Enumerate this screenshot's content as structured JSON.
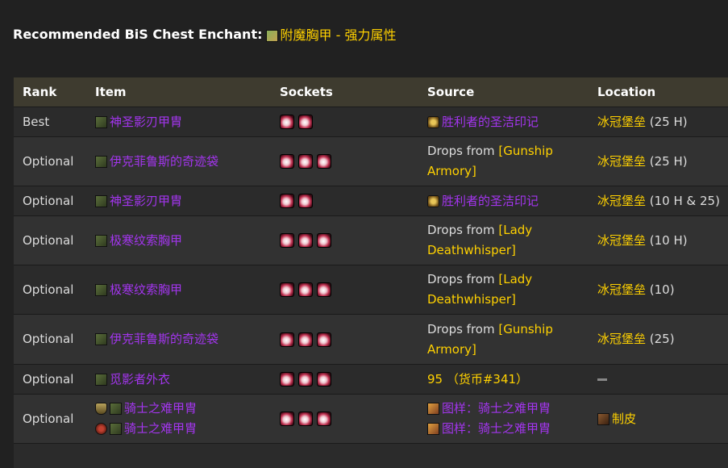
{
  "enchant": {
    "label": "Recommended BiS Chest Enchant:",
    "item": "附魔胸甲 - 强力属性",
    "icon": "enchant-scroll-icon"
  },
  "table": {
    "headers": {
      "rank": "Rank",
      "item": "Item",
      "sockets": "Sockets",
      "source": "Source",
      "location": "Location"
    },
    "rows": [
      {
        "rank": "Best",
        "item": "神圣影刃甲胄",
        "sockets": 2,
        "source_link": "胜利者的圣洁印记",
        "loc_link": "冰冠堡垒",
        "loc_extra": " (25 H)"
      },
      {
        "rank": "Optional",
        "item": "伊克菲鲁斯的奇迹袋",
        "sockets": 3,
        "source_text": "Drops from ",
        "source_link": "[Gunship Armory]",
        "loc_link": "冰冠堡垒",
        "loc_extra": " (25 H)"
      },
      {
        "rank": "Optional",
        "item": "神圣影刃甲胄",
        "sockets": 2,
        "source_link": "胜利者的圣洁印记",
        "loc_link": "冰冠堡垒",
        "loc_extra": " (10 H & 25)"
      },
      {
        "rank": "Optional",
        "item": "极寒纹索胸甲",
        "sockets": 3,
        "source_text": "Drops from ",
        "source_link": "[Lady Deathwhisper]",
        "loc_link": "冰冠堡垒",
        "loc_extra": " (10 H)"
      },
      {
        "rank": "Optional",
        "item": "极寒纹索胸甲",
        "sockets": 3,
        "source_text": "Drops from ",
        "source_link": "[Lady Deathwhisper]",
        "loc_link": "冰冠堡垒",
        "loc_extra": " (10)"
      },
      {
        "rank": "Optional",
        "item": "伊克菲鲁斯的奇迹袋",
        "sockets": 3,
        "source_text": "Drops from ",
        "source_link": "[Gunship Armory]",
        "loc_link": "冰冠堡垒",
        "loc_extra": " (25)"
      },
      {
        "rank": "Optional",
        "item": "觅影者外衣",
        "sockets": 3,
        "source_currency": "95 （货币#341）"
      },
      {
        "rank": "Optional",
        "item_a": "骑士之难甲胄",
        "item_b": "骑士之难甲胄",
        "sockets": 3,
        "pattern_a": "图样：骑士之难甲胄",
        "pattern_b": "图样：骑士之难甲胄",
        "profession": "制皮"
      }
    ]
  },
  "colors": {
    "epic": "#a335ee",
    "link": "#ffd100",
    "header_bg": "#3e3b2f",
    "page_bg": "#212121"
  }
}
